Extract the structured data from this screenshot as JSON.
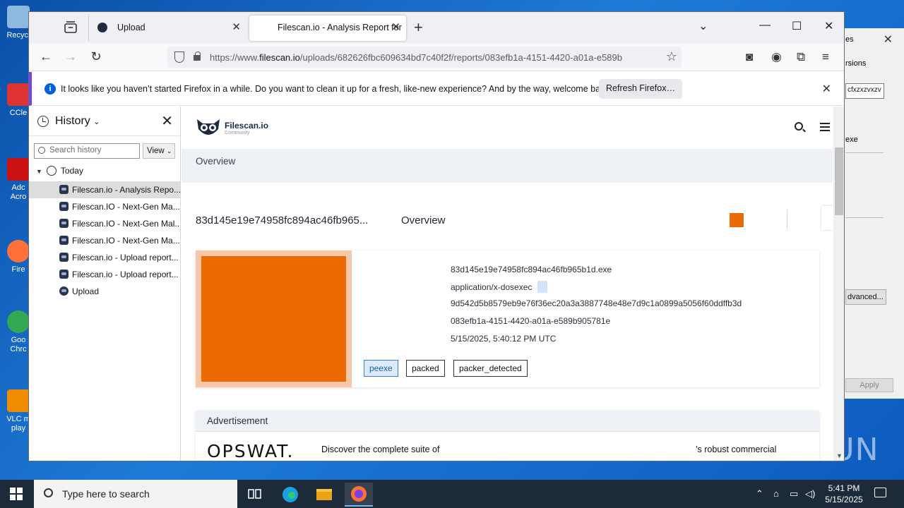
{
  "desktop": {
    "icons": [
      {
        "label": "Recycl",
        "name": "recycle-bin"
      },
      {
        "label": "CCle",
        "name": "ccleaner"
      },
      {
        "label": "Adc Acro",
        "name": "acrobat"
      },
      {
        "label": "Fire",
        "name": "firefox"
      },
      {
        "label": "Goo Chrc",
        "name": "chrome"
      },
      {
        "label": "VLC m play",
        "name": "vlc"
      }
    ],
    "watermark": "ANY RUN"
  },
  "bg_window": {
    "tab_label": "rsions",
    "text_es": "es",
    "field_value": "cfxzxzvxzv",
    "exe_label": "exe",
    "advanced_label": "dvanced...",
    "apply_label": "Apply"
  },
  "browser": {
    "tabs": [
      {
        "label": "Upload"
      },
      {
        "label": "Filescan.io - Analysis Report for"
      }
    ],
    "url_prefix": "https://www.",
    "url_host": "filescan.io",
    "url_path": "/uploads/682626fbc609634bd7c40f2f/reports/083efb1a-4151-4420-a01a-e589b",
    "notification": {
      "message": "It looks like you haven’t started Firefox in a while. Do you want to clean it up for a fresh, like-new experience? And by the way, welcome back!",
      "button": "Refresh Firefox…"
    }
  },
  "sidebar": {
    "title": "History",
    "search_placeholder": "Search history",
    "view_label": "View",
    "group": "Today",
    "items": [
      {
        "label": "Filescan.io - Analysis Repo..."
      },
      {
        "label": "Filescan.IO - Next-Gen Ma..."
      },
      {
        "label": "Filescan.IO - Next-Gen Mal..."
      },
      {
        "label": "Filescan.IO - Next-Gen Ma..."
      },
      {
        "label": "Filescan.io - Upload report..."
      },
      {
        "label": "Filescan.io - Upload report..."
      },
      {
        "label": "Upload"
      }
    ]
  },
  "page": {
    "logo_name": "Filescan.io",
    "logo_sub": "Community",
    "overview_bar": "Overview",
    "file_title": "83d145e19e74958fc894ac46fb965...",
    "file_title_sub": "Overview",
    "details": {
      "filename": "83d145e19e74958fc894ac46fb965b1d.exe",
      "mime": "application/x-dosexec",
      "sha256": "9d542d5b8579eb9e76f36ec20a3a3887748e48e7d9c1a0899a5056f60ddffb3d",
      "report_id": "083efb1a-4151-4420-a01a-e589b905781e",
      "date": "5/15/2025, 5:40:12 PM UTC"
    },
    "tags": [
      "peexe",
      "packed",
      "packer_detected"
    ],
    "ad": {
      "heading": "Advertisement",
      "brand": "OPSWAT.",
      "copy": "Discover the complete suite of",
      "copy2": "’s robust commercial"
    }
  },
  "taskbar": {
    "search_placeholder": "Type here to search",
    "time": "5:41 PM",
    "date": "5/15/2025"
  }
}
